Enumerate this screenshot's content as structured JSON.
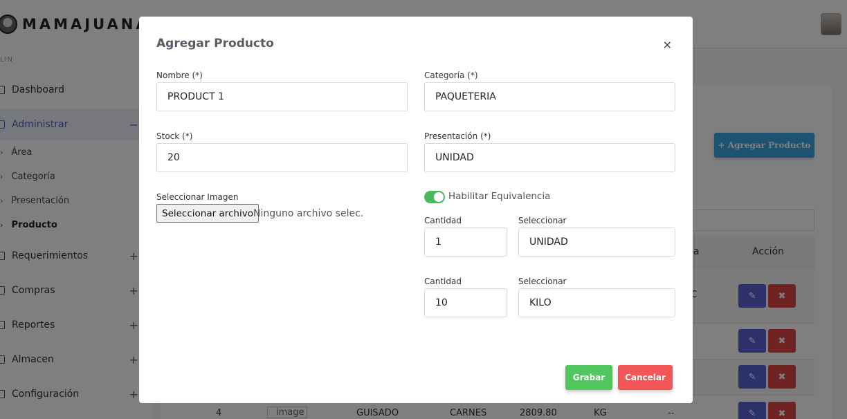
{
  "brand": {
    "name": "MAMAJUANA"
  },
  "sidebar": {
    "section_label": "LIN",
    "items": [
      {
        "label": "Dashboard",
        "plus": ""
      },
      {
        "label": "Administrar",
        "plus": "−"
      },
      {
        "label": "Requerimientos",
        "plus": "+"
      },
      {
        "label": "Compras",
        "plus": "+"
      },
      {
        "label": "Reportes",
        "plus": "+"
      },
      {
        "label": "Almacen",
        "plus": "+"
      },
      {
        "label": "Configuración",
        "plus": "+"
      }
    ],
    "subitems": [
      {
        "label": "Área"
      },
      {
        "label": "Categoría"
      },
      {
        "label": "Presentación"
      },
      {
        "label": "Producto"
      }
    ]
  },
  "background": {
    "add_button_label": "+ Agregar Producto",
    "table_header_clip": "ia",
    "table_header_action": "Acción",
    "row1_clip": "C",
    "edit_icon": "✎",
    "delete_icon": "✖",
    "bottom_row": {
      "num": "4",
      "image": "image",
      "name": "GUISADO",
      "category": "CARNES",
      "stock": "2809.80",
      "unit": "KG",
      "dash": "---"
    }
  },
  "modal": {
    "title": "Agregar Producto",
    "close": "×",
    "nombre_label": "Nombre (*)",
    "nombre_value": "PRODUCT 1",
    "categoria_label": "Categoría (*)",
    "categoria_value": "PAQUETERIA",
    "stock_label": "Stock (*)",
    "stock_value": "20",
    "presentacion_label": "Presentación (*)",
    "presentacion_value": "UNIDAD",
    "imagen_label": "Seleccionar Imagen",
    "file_button": "Seleccionar archivo",
    "file_status": "Ninguno archivo selec.",
    "toggle_label": "Habilitar Equivalencia",
    "toggle_on": true,
    "equivalencias": [
      {
        "cantidad_label": "Cantidad",
        "cantidad_value": "1",
        "select_label": "Seleccionar",
        "select_value": "UNIDAD"
      },
      {
        "cantidad_label": "Cantidad",
        "cantidad_value": "10",
        "select_label": "Seleccionar",
        "select_value": "KILO"
      }
    ],
    "save_label": "Grabar",
    "cancel_label": "Cancelar"
  },
  "colors": {
    "primary": "#4f5dc8",
    "success": "#51c55e",
    "danger": "#f25656",
    "info": "#3aa6e0"
  }
}
